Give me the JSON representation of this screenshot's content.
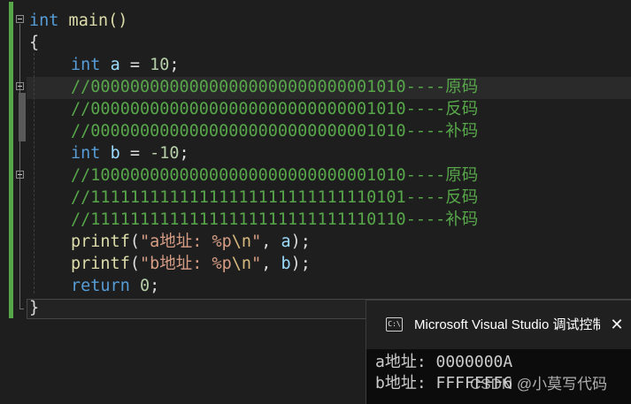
{
  "editor": {
    "lines": {
      "l1": {
        "kw": "int",
        "rest": " main()"
      },
      "l2": {
        "text": "{"
      },
      "l3": {
        "kw": "int",
        "var": "a",
        "op": " = ",
        "num": "10",
        "end": ";"
      },
      "l4": {
        "comment": "//00000000000000000000000000001010----原码"
      },
      "l5": {
        "comment": "//00000000000000000000000000001010----反码"
      },
      "l6": {
        "comment": "//00000000000000000000000000001010----补码"
      },
      "l7": {
        "kw": "int",
        "var": "b",
        "op": " = ",
        "num": "-10",
        "end": ";"
      },
      "l8": {
        "comment": "//10000000000000000000000000001010----原码"
      },
      "l9": {
        "comment": "//11111111111111111111111111110101----反码"
      },
      "l10": {
        "comment": "//11111111111111111111111111110110----补码"
      },
      "l11": {
        "fn": "printf",
        "open": "(",
        "str": "\"a地址: %p",
        "esc": "\\n",
        "strEnd": "\"",
        "sep": ", ",
        "var": "a",
        "close": ");"
      },
      "l12": {
        "fn": "printf",
        "open": "(",
        "str": "\"b地址: %p",
        "esc": "\\n",
        "strEnd": "\"",
        "sep": ", ",
        "var": "b",
        "close": ");"
      },
      "l13": {
        "kw": "return",
        "sp": " ",
        "num": "0",
        "end": ";"
      },
      "l14": {
        "text": "}"
      }
    }
  },
  "console": {
    "title": "Microsoft Visual Studio 调试控制台",
    "close": "✕",
    "iconText": "C:\\",
    "output": [
      "a地址: 0000000A",
      "b地址: FFFFFFF6"
    ],
    "watermark": "CSDN @小莫写代码"
  }
}
